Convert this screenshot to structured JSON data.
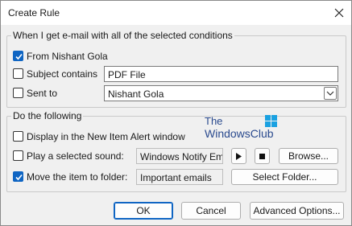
{
  "window": {
    "title": "Create Rule"
  },
  "conditions": {
    "group_label": "When I get e-mail with all of the selected conditions",
    "from": {
      "label": "From Nishant Gola",
      "checked": true
    },
    "subject": {
      "label": "Subject contains",
      "checked": false,
      "value": "PDF File"
    },
    "sent_to": {
      "label": "Sent to",
      "checked": false,
      "value": "Nishant Gola"
    }
  },
  "actions": {
    "group_label": "Do the following",
    "alert": {
      "label": "Display in the New Item Alert window",
      "checked": false
    },
    "sound": {
      "label": "Play a selected sound:",
      "checked": false,
      "value": "Windows Notify Em",
      "browse_label": "Browse..."
    },
    "move": {
      "label": "Move the item to folder:",
      "checked": true,
      "value": "Important emails",
      "select_label": "Select Folder..."
    }
  },
  "watermark": {
    "line1": "The",
    "line2": "WindowsClub"
  },
  "footer": {
    "ok_label": "OK",
    "cancel_label": "Cancel",
    "advanced_label": "Advanced Options..."
  },
  "colors": {
    "accent": "#0f65c3"
  }
}
